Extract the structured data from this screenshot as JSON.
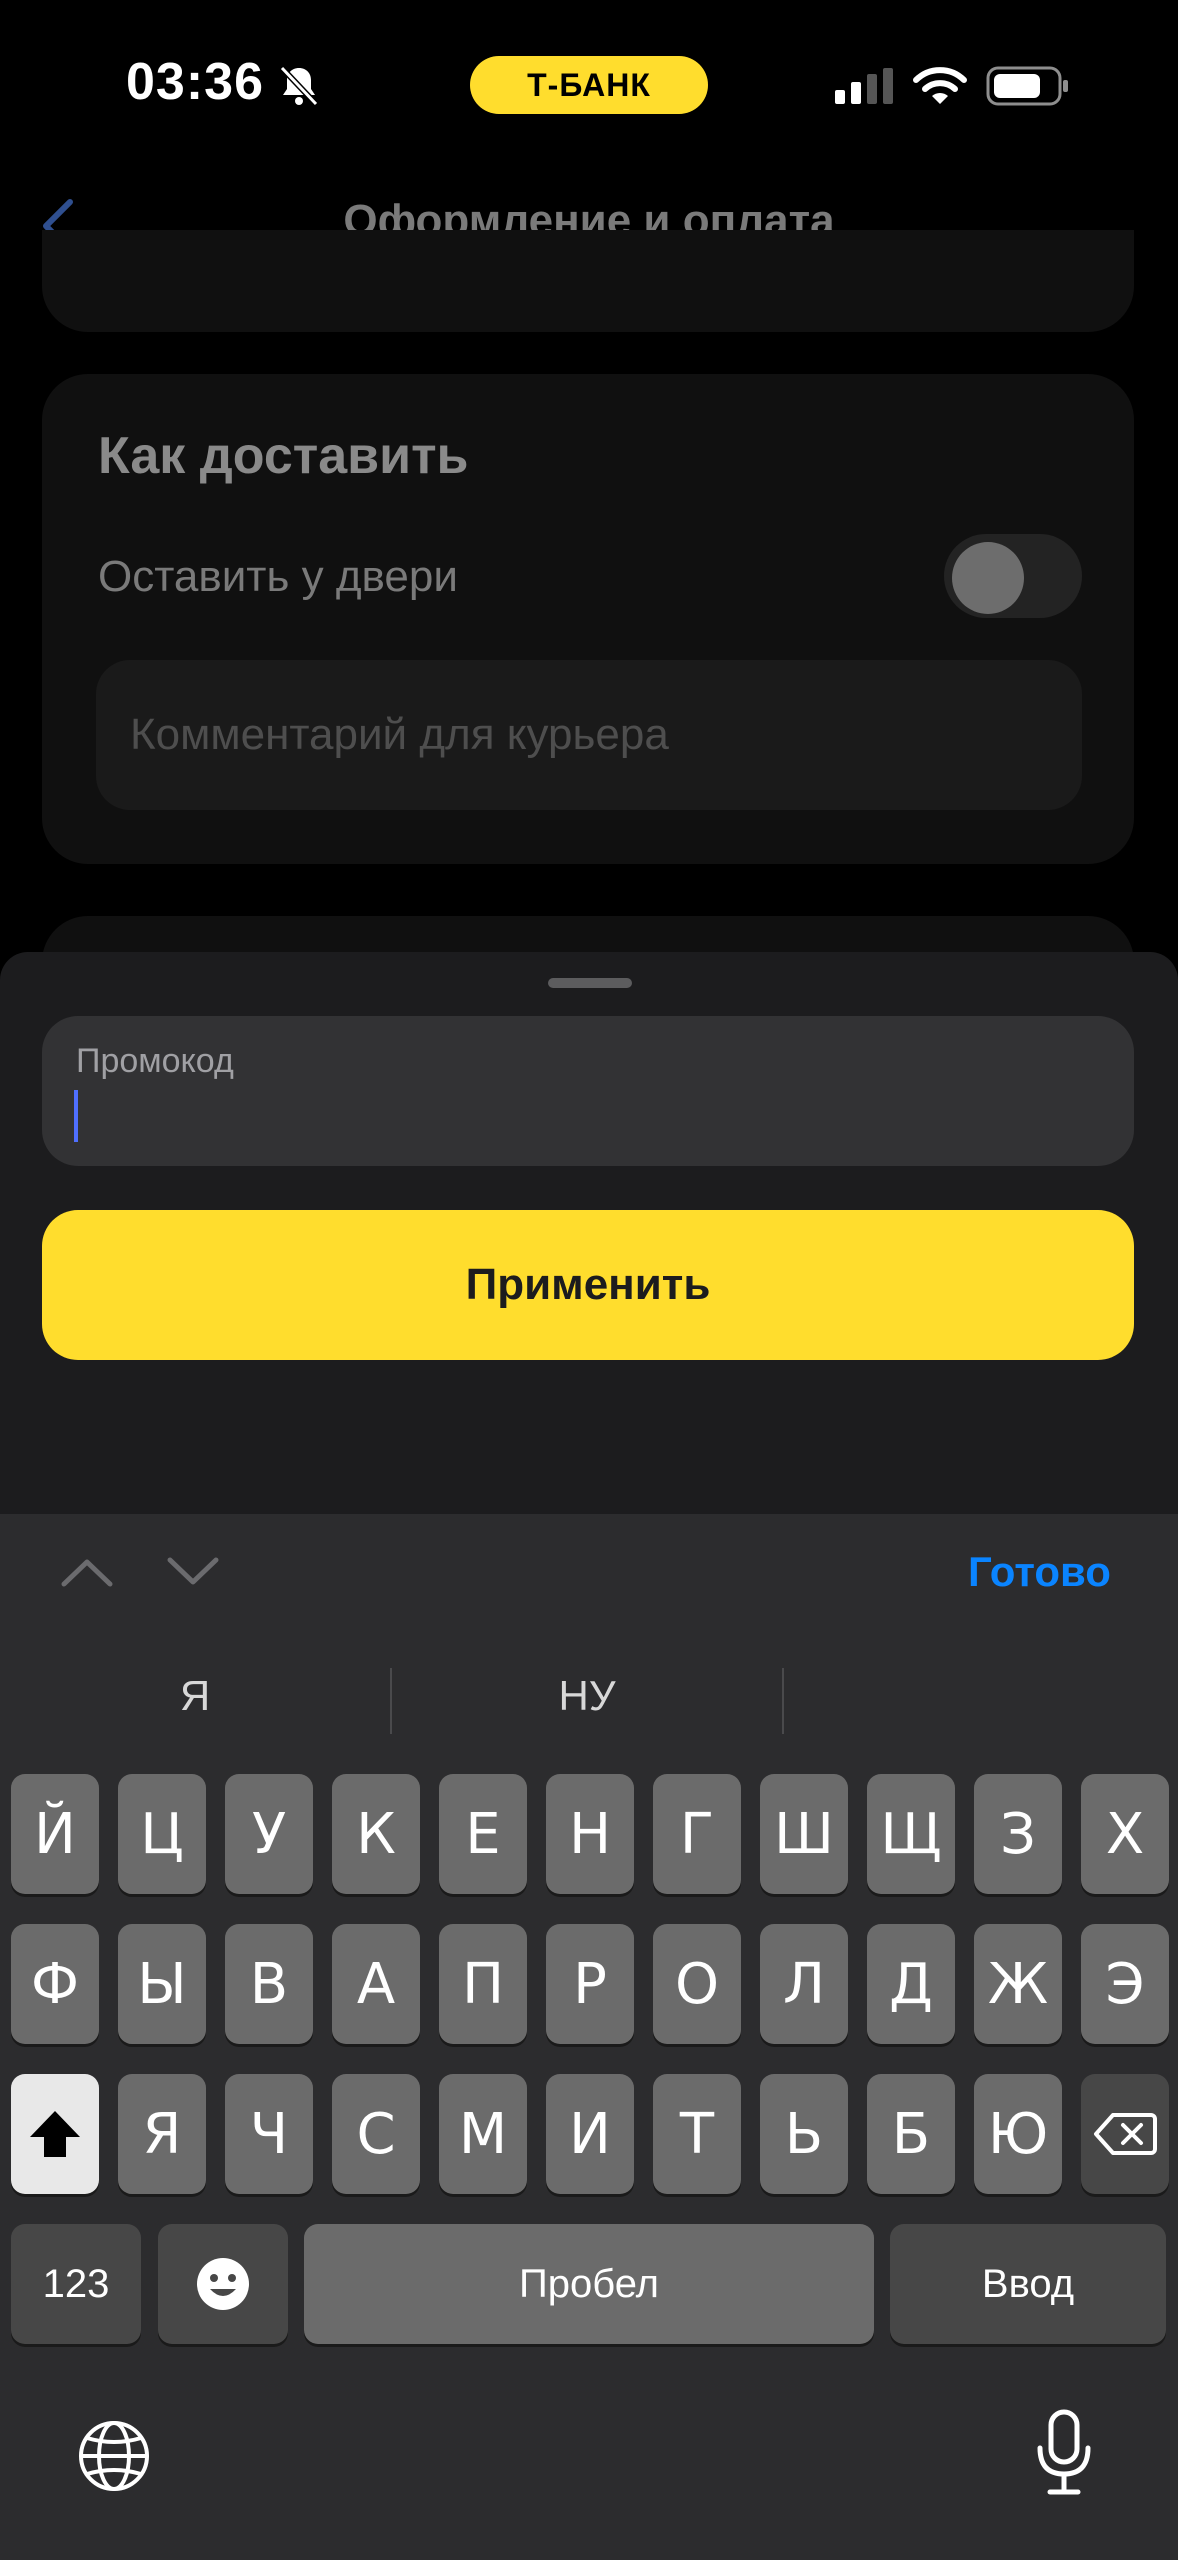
{
  "status_bar": {
    "time": "03:36",
    "carrier_badge": "Т-БАНК"
  },
  "header": {
    "title": "Оформление и оплата"
  },
  "delivery_card": {
    "title": "Как доставить",
    "leave_at_door_label": "Оставить у двери",
    "leave_at_door_enabled": false,
    "comment_placeholder": "Комментарий для курьера"
  },
  "sheet": {
    "promo_label": "Промокод",
    "promo_value": "",
    "apply_label": "Применить"
  },
  "keyboard_toolbar": {
    "done_label": "Готово"
  },
  "keyboard": {
    "suggestions": [
      "Я",
      "НУ",
      ""
    ],
    "row1": [
      "Й",
      "Ц",
      "У",
      "К",
      "Е",
      "Н",
      "Г",
      "Ш",
      "Щ",
      "З",
      "Х"
    ],
    "row2": [
      "Ф",
      "Ы",
      "В",
      "А",
      "П",
      "Р",
      "О",
      "Л",
      "Д",
      "Ж",
      "Э"
    ],
    "row3": [
      "Я",
      "Ч",
      "С",
      "М",
      "И",
      "Т",
      "Ь",
      "Б",
      "Ю"
    ],
    "numbers_label": "123",
    "space_label": "Пробел",
    "return_label": "Ввод"
  },
  "colors": {
    "accent_yellow": "#ffdd2d",
    "link_blue": "#0a84ff",
    "caret_blue": "#4f6fff"
  }
}
